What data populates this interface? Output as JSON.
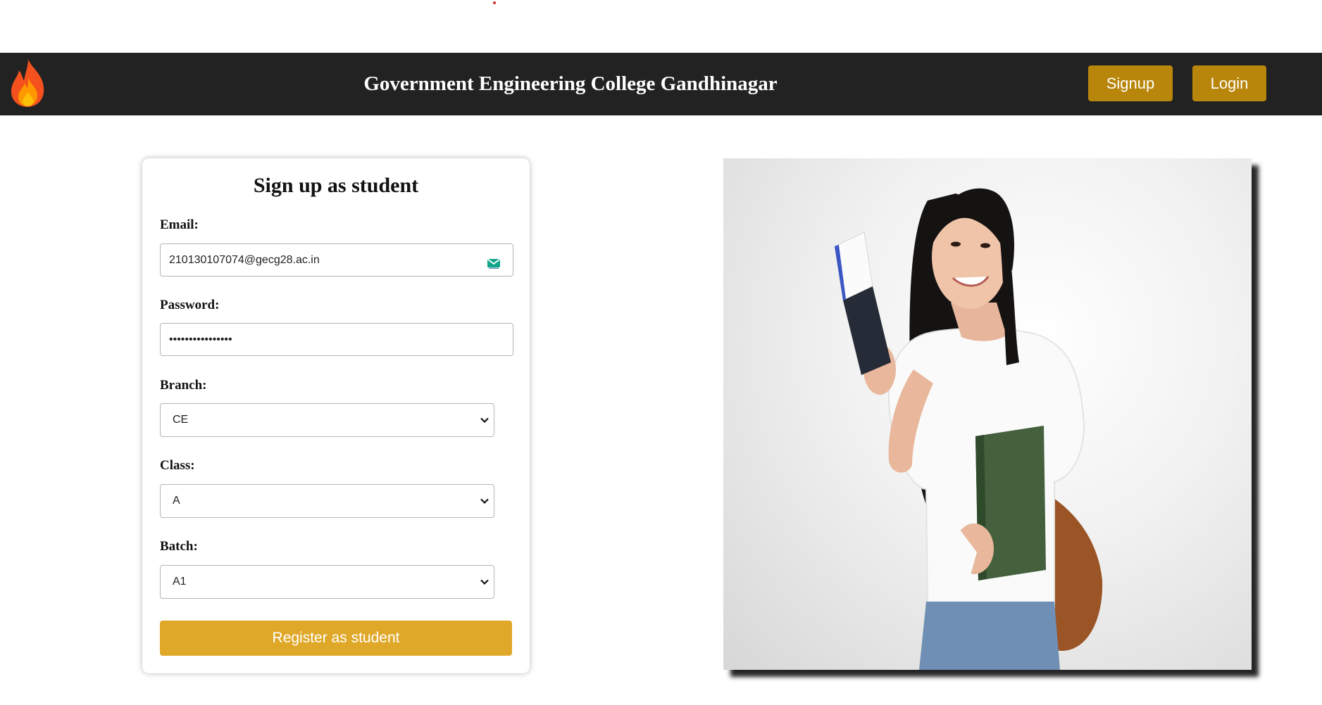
{
  "header": {
    "title": "Government Engineering College Gandhinagar",
    "logo_icon": "flame-icon",
    "signup_label": "Signup",
    "login_label": "Login"
  },
  "form": {
    "title": "Sign up as student",
    "email": {
      "label": "Email:",
      "value": "210130107074@gecg28.ac.in",
      "icon": "mail-icon"
    },
    "password": {
      "label": "Password:",
      "value": "••••••••••••••••"
    },
    "branch": {
      "label": "Branch:",
      "value": "CE"
    },
    "class": {
      "label": "Class:",
      "value": "A"
    },
    "batch": {
      "label": "Batch:",
      "value": "A1"
    },
    "submit_label": "Register as student"
  },
  "colors": {
    "navbar": "#222222",
    "nav_button": "#b8860b",
    "register_button": "#e0a828"
  }
}
